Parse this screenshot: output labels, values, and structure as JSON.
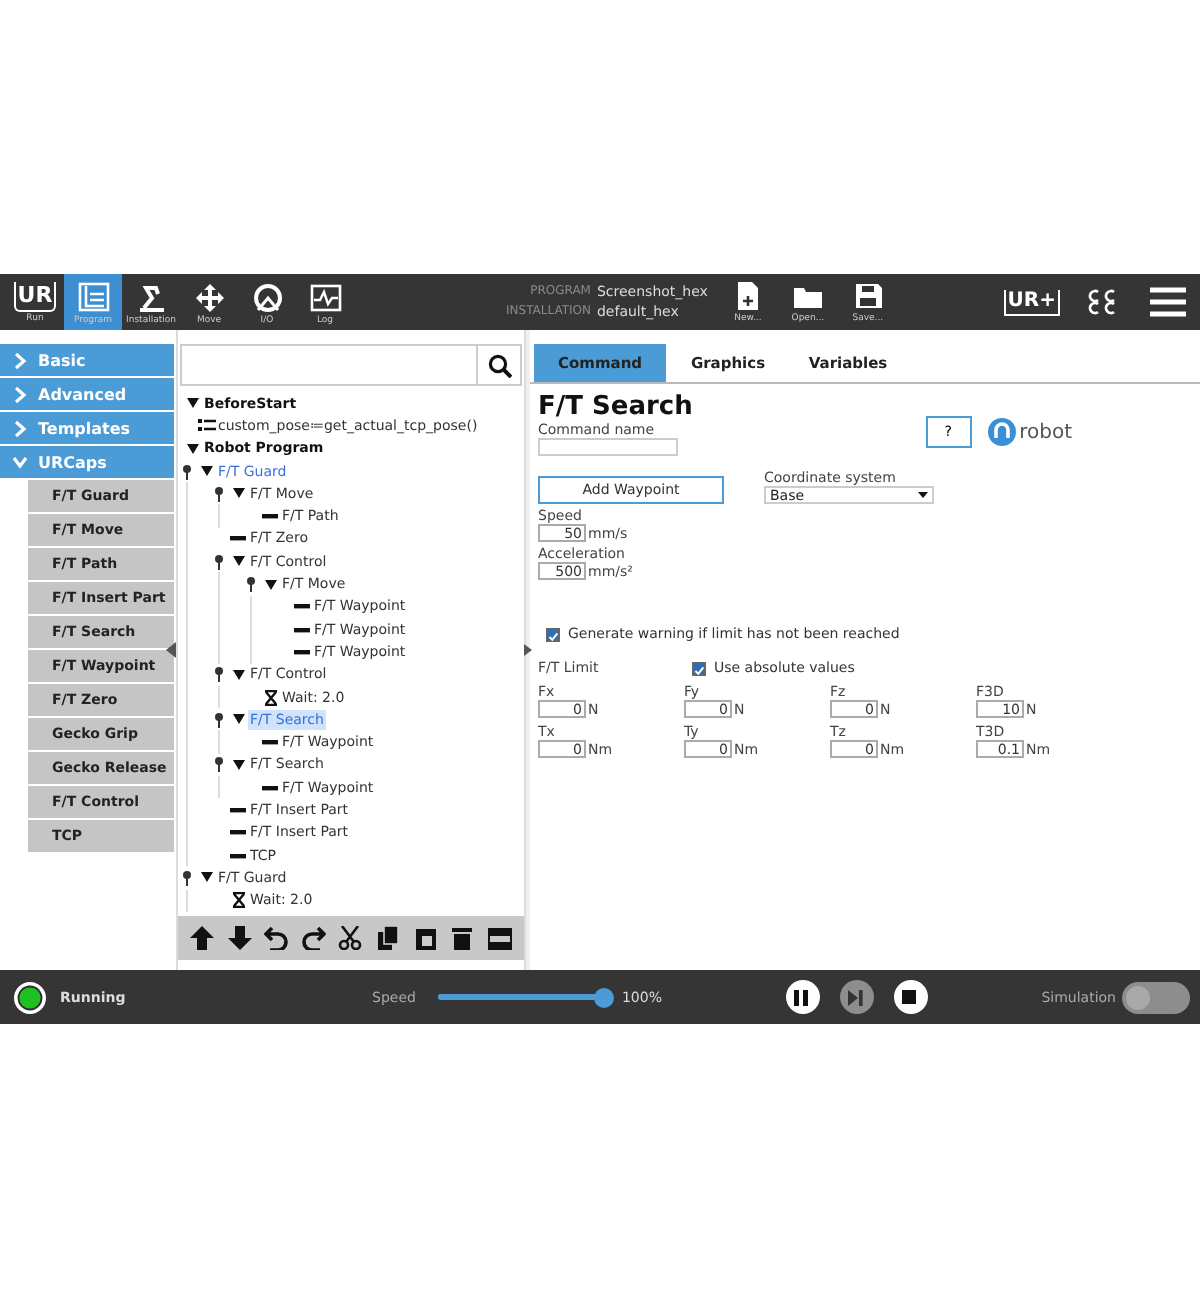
{
  "header": {
    "logo": "UR",
    "nav": [
      {
        "label": "Run",
        "selected": false
      },
      {
        "label": "Program",
        "selected": true
      },
      {
        "label": "Installation",
        "selected": false
      },
      {
        "label": "Move",
        "selected": false
      },
      {
        "label": "I/O",
        "selected": false
      },
      {
        "label": "Log",
        "selected": false
      }
    ],
    "program_label": "PROGRAM",
    "program": "Screenshot_hex",
    "installation_label": "INSTALLATION",
    "installation": "default_hex",
    "file_buttons": [
      {
        "label": "New..."
      },
      {
        "label": "Open..."
      },
      {
        "label": "Save..."
      }
    ],
    "urplus_logo": "UR+"
  },
  "sidebar": {
    "categories": [
      {
        "label": "Basic",
        "expanded": false
      },
      {
        "label": "Advanced",
        "expanded": false
      },
      {
        "label": "Templates",
        "expanded": false
      },
      {
        "label": "URCaps",
        "expanded": true,
        "children": [
          {
            "label": "F/T Guard"
          },
          {
            "label": "F/T Move"
          },
          {
            "label": "F/T Path"
          },
          {
            "label": "F/T Insert Part"
          },
          {
            "label": "F/T Search"
          },
          {
            "label": "F/T Waypoint"
          },
          {
            "label": "F/T Zero"
          },
          {
            "label": "Gecko Grip"
          },
          {
            "label": "Gecko Release"
          },
          {
            "label": "F/T Control"
          },
          {
            "label": "TCP"
          }
        ]
      }
    ]
  },
  "tree": {
    "nodes": [
      {
        "label": "BeforeStart",
        "kind": "section",
        "expanded": true,
        "children": [
          {
            "label": "custom_pose≔get_actual_tcp_pose()",
            "kind": "assignment",
            "pinned": false,
            "selected": false,
            "accent": false
          }
        ]
      },
      {
        "label": "Robot Program",
        "kind": "section",
        "expanded": true,
        "children": [
          {
            "label": "F/T Guard",
            "kind": "command",
            "pinned": true,
            "selected": false,
            "accent": true,
            "expanded": true,
            "children": [
              {
                "label": "F/T Move",
                "kind": "command",
                "pinned": true,
                "selected": false,
                "accent": false,
                "expanded": true,
                "children": [
                  {
                    "label": "F/T Path",
                    "kind": "command",
                    "pinned": false,
                    "selected": false,
                    "accent": false
                  }
                ]
              },
              {
                "label": "F/T Zero",
                "kind": "command",
                "pinned": false,
                "selected": false,
                "accent": false
              },
              {
                "label": "F/T Control",
                "kind": "command",
                "pinned": true,
                "selected": false,
                "accent": false,
                "expanded": true,
                "children": [
                  {
                    "label": "F/T Move",
                    "kind": "command",
                    "pinned": true,
                    "selected": false,
                    "accent": false,
                    "expanded": true,
                    "children": [
                      {
                        "label": "F/T Waypoint",
                        "kind": "command",
                        "pinned": false,
                        "selected": false,
                        "accent": false
                      },
                      {
                        "label": "F/T Waypoint",
                        "kind": "command",
                        "pinned": false,
                        "selected": false,
                        "accent": false
                      },
                      {
                        "label": "F/T Waypoint",
                        "kind": "command",
                        "pinned": false,
                        "selected": false,
                        "accent": false
                      }
                    ]
                  }
                ]
              },
              {
                "label": "F/T Control",
                "kind": "command",
                "pinned": true,
                "selected": false,
                "accent": false,
                "expanded": true,
                "children": [
                  {
                    "label": "Wait: 2.0",
                    "kind": "wait",
                    "pinned": false,
                    "selected": false,
                    "accent": false
                  }
                ]
              },
              {
                "label": "F/T Search",
                "kind": "command",
                "pinned": true,
                "selected": true,
                "accent": true,
                "expanded": true,
                "children": [
                  {
                    "label": "F/T Waypoint",
                    "kind": "command",
                    "pinned": false,
                    "selected": false,
                    "accent": false
                  }
                ]
              },
              {
                "label": "F/T Search",
                "kind": "command",
                "pinned": true,
                "selected": false,
                "accent": false,
                "expanded": true,
                "children": [
                  {
                    "label": "F/T Waypoint",
                    "kind": "command",
                    "pinned": false,
                    "selected": false,
                    "accent": false
                  }
                ]
              },
              {
                "label": "F/T Insert Part",
                "kind": "command",
                "pinned": false,
                "selected": false,
                "accent": false
              },
              {
                "label": "F/T Insert Part",
                "kind": "command",
                "pinned": false,
                "selected": false,
                "accent": false
              },
              {
                "label": "TCP",
                "kind": "command",
                "pinned": false,
                "selected": false,
                "accent": false
              }
            ]
          },
          {
            "label": "F/T Guard",
            "kind": "command",
            "pinned": true,
            "selected": false,
            "accent": false,
            "expanded": true,
            "children": [
              {
                "label": "Wait: 2.0",
                "kind": "wait",
                "pinned": false,
                "selected": false,
                "accent": false
              }
            ]
          }
        ]
      }
    ]
  },
  "form": {
    "tabs": [
      {
        "label": "Command",
        "selected": true
      },
      {
        "label": "Graphics",
        "selected": false
      },
      {
        "label": "Variables",
        "selected": false
      }
    ],
    "title": "F/T Search",
    "command_name_label": "Command name",
    "help_button": "?",
    "logo_text": "robot",
    "add_waypoint": "Add Waypoint",
    "coordinate_label": "Coordinate system",
    "coordinate_value": "Base",
    "speed": {
      "label": "Speed",
      "value": "50",
      "unit": "mm/s"
    },
    "acceleration": {
      "label": "Acceleration",
      "value": "500",
      "unit": "mm/s²"
    },
    "warning": {
      "label": "Generate warning if limit has not been reached",
      "checked": true
    },
    "limit_label": "F/T Limit",
    "absolute": {
      "label": "Use absolute values",
      "checked": true
    },
    "limits": [
      {
        "label": "Fx",
        "value": "0",
        "unit": "N"
      },
      {
        "label": "Fy",
        "value": "0",
        "unit": "N"
      },
      {
        "label": "Fz",
        "value": "0",
        "unit": "N"
      },
      {
        "label": "F3D",
        "value": "10",
        "unit": "N"
      },
      {
        "label": "Tx",
        "value": "0",
        "unit": "Nm"
      },
      {
        "label": "Ty",
        "value": "0",
        "unit": "Nm"
      },
      {
        "label": "Tz",
        "value": "0",
        "unit": "Nm"
      },
      {
        "label": "T3D",
        "value": "0.1",
        "unit": "Nm"
      }
    ]
  },
  "bottom": {
    "status": "Running",
    "speed_label": "Speed",
    "speed": {
      "level": 1.0,
      "reading": "100%"
    },
    "controls": [
      {
        "disabled": false
      },
      {
        "disabled": true
      },
      {
        "disabled": false
      }
    ],
    "simulation": {
      "label": "Simulation",
      "on": false
    }
  }
}
